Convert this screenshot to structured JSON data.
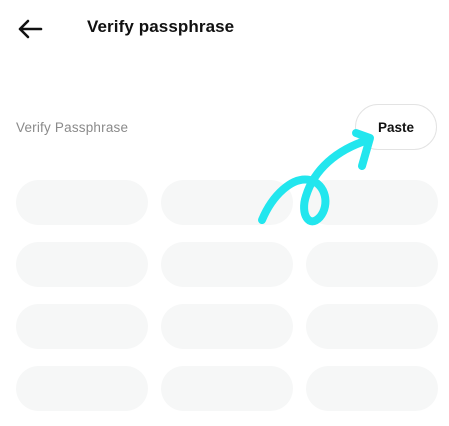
{
  "header": {
    "back_icon": "arrow-left-icon",
    "title": "Verify passphrase"
  },
  "verify": {
    "label": "Verify Passphrase",
    "paste_label": "Paste"
  },
  "word_grid": {
    "slot_count": 12,
    "columns": 3,
    "slot_values": [
      "",
      "",
      "",
      "",
      "",
      "",
      "",
      "",
      "",
      "",
      "",
      ""
    ]
  },
  "annotation": {
    "icon": "hand-drawn-arrow",
    "color": "#22e6ee"
  }
}
